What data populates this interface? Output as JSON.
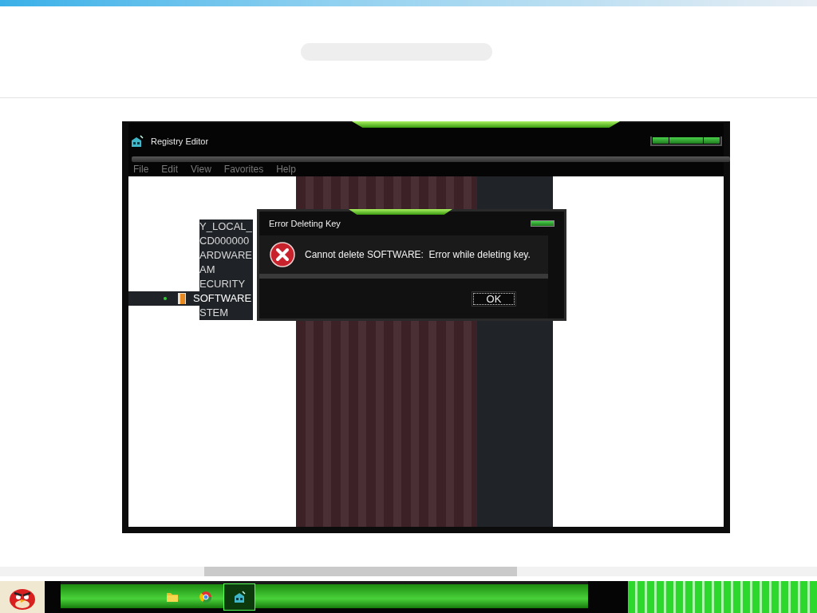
{
  "window": {
    "title": "Registry Editor"
  },
  "menu": [
    {
      "label": "File"
    },
    {
      "label": "Edit"
    },
    {
      "label": "View"
    },
    {
      "label": "Favorites"
    },
    {
      "label": "Help"
    }
  ],
  "tree": {
    "label": "Y_LOCAL_",
    "children": [
      {
        "label": "CD000000",
        "selected": false
      },
      {
        "label": "ARDWARE",
        "selected": false
      },
      {
        "label": "AM",
        "selected": false
      },
      {
        "label": "ECURITY",
        "selected": false
      },
      {
        "label": "SOFTWARE",
        "selected": true
      },
      {
        "label": "STEM",
        "selected": false
      }
    ]
  },
  "dialog": {
    "title": "Error Deleting Key",
    "message": "Cannot delete SOFTWARE:  Error while deleting key.",
    "buttons": [
      {
        "label": "OK",
        "focused": true
      }
    ]
  },
  "taskbar": {
    "items": [
      {
        "kind": "folder",
        "active": false
      },
      {
        "kind": "browser",
        "active": false
      },
      {
        "kind": "registry",
        "active": true
      }
    ]
  }
}
